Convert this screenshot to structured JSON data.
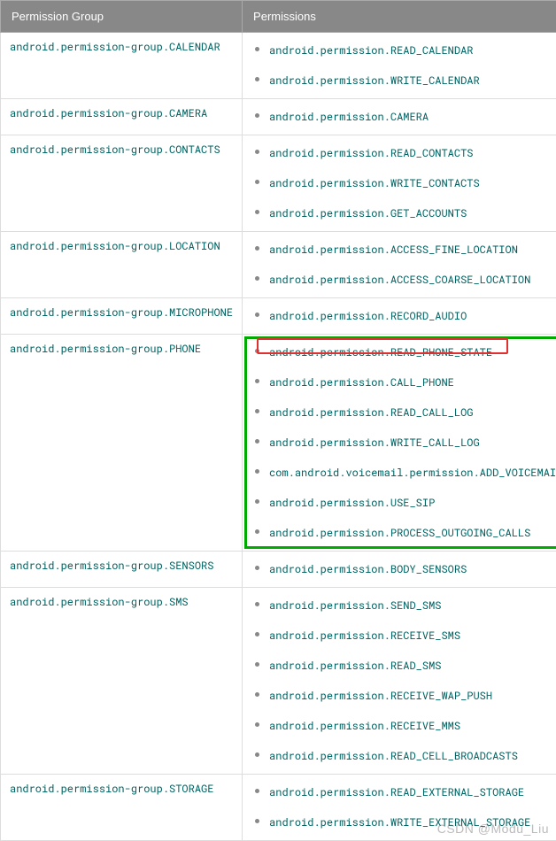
{
  "headers": {
    "group": "Permission Group",
    "perms": "Permissions"
  },
  "rows": [
    {
      "group": "android.permission-group.CALENDAR",
      "perms": [
        "android.permission.READ_CALENDAR",
        "android.permission.WRITE_CALENDAR"
      ]
    },
    {
      "group": "android.permission-group.CAMERA",
      "perms": [
        "android.permission.CAMERA"
      ]
    },
    {
      "group": "android.permission-group.CONTACTS",
      "perms": [
        "android.permission.READ_CONTACTS",
        "android.permission.WRITE_CONTACTS",
        "android.permission.GET_ACCOUNTS"
      ]
    },
    {
      "group": "android.permission-group.LOCATION",
      "perms": [
        "android.permission.ACCESS_FINE_LOCATION",
        "android.permission.ACCESS_COARSE_LOCATION"
      ]
    },
    {
      "group": "android.permission-group.MICROPHONE",
      "perms": [
        "android.permission.RECORD_AUDIO"
      ]
    },
    {
      "group": "android.permission-group.PHONE",
      "highlight": true,
      "redbox_on": 0,
      "perms": [
        "android.permission.READ_PHONE_STATE",
        "android.permission.CALL_PHONE",
        "android.permission.READ_CALL_LOG",
        "android.permission.WRITE_CALL_LOG",
        "com.android.voicemail.permission.ADD_VOICEMAIL",
        "android.permission.USE_SIP",
        "android.permission.PROCESS_OUTGOING_CALLS"
      ]
    },
    {
      "group": "android.permission-group.SENSORS",
      "perms": [
        "android.permission.BODY_SENSORS"
      ]
    },
    {
      "group": "android.permission-group.SMS",
      "perms": [
        "android.permission.SEND_SMS",
        "android.permission.RECEIVE_SMS",
        "android.permission.READ_SMS",
        "android.permission.RECEIVE_WAP_PUSH",
        "android.permission.RECEIVE_MMS",
        "android.permission.READ_CELL_BROADCASTS"
      ]
    },
    {
      "group": "android.permission-group.STORAGE",
      "perms": [
        "android.permission.READ_EXTERNAL_STORAGE",
        "android.permission.WRITE_EXTERNAL_STORAGE"
      ]
    }
  ],
  "watermark": "CSDN @Modu_Liu"
}
